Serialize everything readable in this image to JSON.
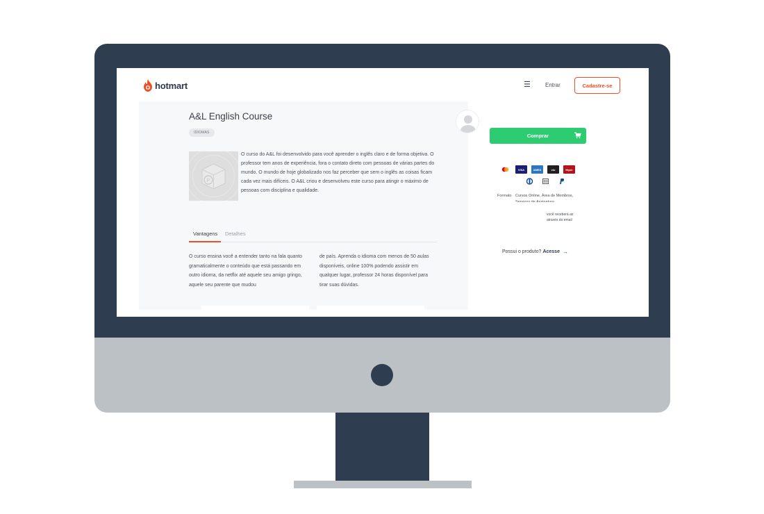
{
  "header": {
    "logo_text": "hotmart",
    "menu_icon": "hamburger-icon",
    "login_label": "Entrar",
    "signup_label": "Cadastre-se",
    "brand_color": "#f04e23"
  },
  "product": {
    "title": "A&L English Course",
    "tag": "IDIOMAS",
    "description": "O curso do A&L foi desenvolvido para você aprender o inglês claro e de forma objetiva. O professor tem anos de experiência, fora o contato direto com pessoas de várias partes do mundo. O mundo de hoje globalizado nos faz perceber que sem o inglês as coisas ficam cada vez mais difíceis. O A&L criou e desenvolveu este curso para atingir o máximo de pessoas com disciplina e qualidade."
  },
  "tabs": [
    {
      "label": "Vantagens",
      "active": true
    },
    {
      "label": "Detalhes",
      "active": false
    }
  ],
  "advantages": {
    "left": "O curso ensina você a entender tanto na fala quanto gramaticalmente o conteúdo que está passando em outro idioma, da netflix até aquele seu amigo gringo, aquele seu parente que mudou",
    "right": "de país. Aprenda o idioma com menos de 50 aulas disponíveis, online 100% podendo assistir em qualquer lugar, professor 24 horas disponível para tirar suas dúvidas."
  },
  "purchase": {
    "buy_label": "Comprar",
    "buy_color": "#2ecc71",
    "format_label": "Formato",
    "format_value": "Cursos Online, Área de Membros,",
    "format_value_2": "Serviços de Assinatura",
    "access_note": "você receberá as através do email",
    "owns_text": "Possui o produto?",
    "owns_link": "Acesse"
  },
  "payment_methods": [
    "mastercard-icon",
    "visa-icon",
    "amex-icon",
    "elo-icon",
    "hipercard-icon",
    "diners-icon",
    "boleto-icon",
    "paypal-icon"
  ]
}
